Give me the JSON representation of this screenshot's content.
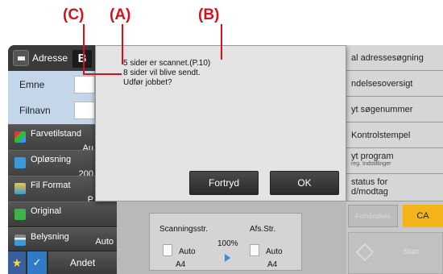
{
  "callouts": {
    "c": "(C)",
    "a": "(A)",
    "b": "(B)"
  },
  "tabs": {
    "address_label": "Adresse",
    "dark_tab_label": "B"
  },
  "fields": [
    {
      "label": "Emne"
    },
    {
      "label": "Filnavn"
    }
  ],
  "menu": {
    "farvetilstand": {
      "label": "Farvetilstand",
      "value": "Au"
    },
    "oplosning": {
      "label": "Opløsning",
      "value": "200"
    },
    "fil_format": {
      "label": "Fil Format",
      "value": "P"
    },
    "original": {
      "label": "Original"
    },
    "belysning": {
      "label": "Belysning",
      "value": "Auto"
    },
    "andet": "Andet"
  },
  "right_panel": [
    {
      "label": "al adressesøgning"
    },
    {
      "label": "ndelsesoversigt"
    },
    {
      "label": "yt søgenummer"
    },
    {
      "label": "Kontrolstempel"
    },
    {
      "label": "yt program",
      "sub": "reg. Indstillinger"
    },
    {
      "label": "status for",
      "label2": "d/modtag"
    }
  ],
  "dialog": {
    "line1": "5 sider er scannet.(P.10)",
    "line2": "8 sider vil blive sendt.",
    "line3": "Udfør jobbet?",
    "cancel_label": "Fortryd",
    "ok_label": "OK"
  },
  "summary": {
    "scan_size_label": "Scanningsstr.",
    "send_size_label": "Afs.Str.",
    "ratio": "100%",
    "scan_mode": "Auto",
    "scan_paper": "A4",
    "send_mode": "Auto",
    "send_paper": "A4"
  },
  "actions": {
    "preview_label": "Forhåndsvis",
    "ca_label": "CA",
    "start_label": "Start"
  },
  "colors": {
    "callout": "#d8101a",
    "ca_button": "#f2b418",
    "field_panel": "#c4d7ea"
  }
}
